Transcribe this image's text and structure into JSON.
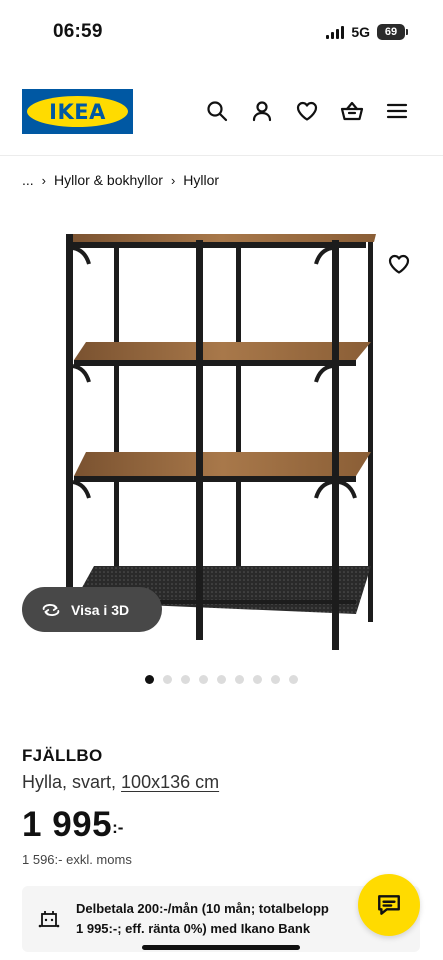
{
  "status_bar": {
    "time": "06:59",
    "network": "5G",
    "battery": "69"
  },
  "header": {
    "logo_text": "IKEA",
    "icons": [
      "search-icon",
      "account-icon",
      "heart-icon",
      "basket-icon",
      "menu-icon"
    ]
  },
  "breadcrumb": {
    "ellipsis": "...",
    "items": [
      "Hyllor & bokhyllor",
      "Hyllor"
    ]
  },
  "gallery": {
    "view_3d_label": "Visa i 3D",
    "image_count": 9,
    "active_index": 0
  },
  "product": {
    "name": "FJÄLLBO",
    "description": "Hylla, svart,",
    "size": "100x136 cm",
    "price_main": "1 995",
    "price_suffix": ":-",
    "price_excl_vat": "1 596:- exkl. moms"
  },
  "financing": {
    "line1": "Delbetala 200:-/mån (10 mån; totalbelopp",
    "line2": "1 995:-; eff. ränta 0%) med Ikano Bank"
  },
  "colors": {
    "ikea_blue": "#0058a3",
    "ikea_yellow": "#ffdb00",
    "shelf_wood": "#9a6b3c",
    "frame_black": "#1c1c1c"
  }
}
